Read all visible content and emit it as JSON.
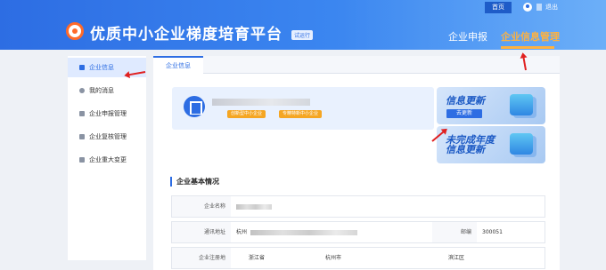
{
  "header": {
    "top_links": {
      "home": "首页",
      "logout": "退出"
    },
    "title": "优质中小企业梯度培育平台",
    "badge": "试运行",
    "nav": [
      {
        "label": "企业申报",
        "active": false
      },
      {
        "label": "企业信息管理",
        "active": true
      }
    ]
  },
  "sidebar": {
    "items": [
      {
        "label": "企业信息",
        "active": true
      },
      {
        "label": "我的消息",
        "active": false
      },
      {
        "label": "企业申报管理",
        "active": false
      },
      {
        "label": "企业复核管理",
        "active": false
      },
      {
        "label": "企业重大变更",
        "active": false
      }
    ]
  },
  "main": {
    "tab": "企业信息",
    "company_card": {
      "tags": [
        "创新型中小企业",
        "专精特新中小企业"
      ]
    },
    "banners": [
      {
        "title": "信息更新",
        "button": "去更新"
      },
      {
        "title_line1": "未完成年度",
        "title_line2": "信息更新"
      }
    ],
    "section_title": "企业基本情况",
    "fields": {
      "name_label": "企业名称",
      "address_label": "通讯地址",
      "address_prefix": "杭州",
      "postcode_label": "邮编",
      "postcode_value": "300051",
      "reg_label": "企业注册地",
      "reg_province": "浙江省",
      "reg_city": "杭州市",
      "reg_district": "滨江区"
    }
  },
  "colors": {
    "primary": "#2d6de3",
    "accent": "#ffb23f",
    "tag": "#f5a623",
    "annotation_arrow": "#e02020"
  }
}
